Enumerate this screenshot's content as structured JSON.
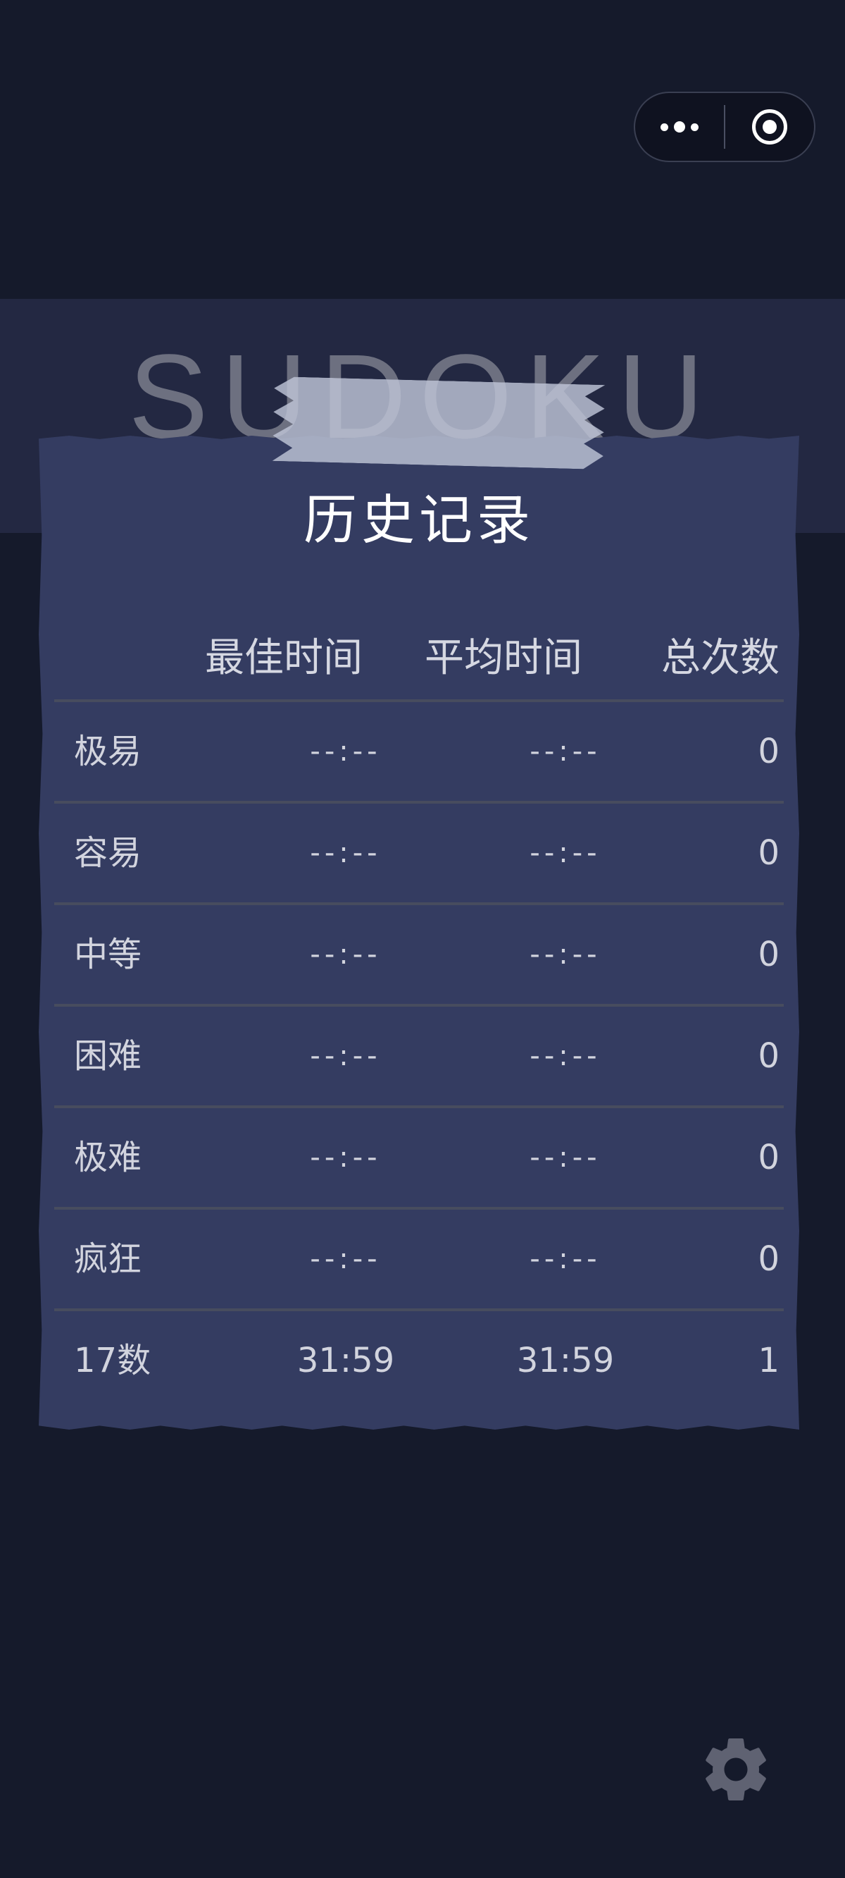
{
  "app": {
    "title": "SUDOKU"
  },
  "capsule": {
    "more_icon": "more-dots-icon",
    "close_icon": "target-close-icon"
  },
  "history": {
    "title": "历史记录",
    "columns": {
      "best": "最佳时间",
      "avg": "平均时间",
      "total": "总次数"
    },
    "rows": [
      {
        "level": "极易",
        "best": "--:--",
        "avg": "--:--",
        "count": "0"
      },
      {
        "level": "容易",
        "best": "--:--",
        "avg": "--:--",
        "count": "0"
      },
      {
        "level": "中等",
        "best": "--:--",
        "avg": "--:--",
        "count": "0"
      },
      {
        "level": "困难",
        "best": "--:--",
        "avg": "--:--",
        "count": "0"
      },
      {
        "level": "极难",
        "best": "--:--",
        "avg": "--:--",
        "count": "0"
      },
      {
        "level": "疯狂",
        "best": "--:--",
        "avg": "--:--",
        "count": "0"
      },
      {
        "level": "17数",
        "best": "31:59",
        "avg": "31:59",
        "count": "1"
      }
    ]
  },
  "settings": {
    "icon": "gear-icon"
  },
  "colors": {
    "background": "#151a2b",
    "card": "#343c61",
    "header_band": "#232842",
    "divider": "#474c5e"
  }
}
